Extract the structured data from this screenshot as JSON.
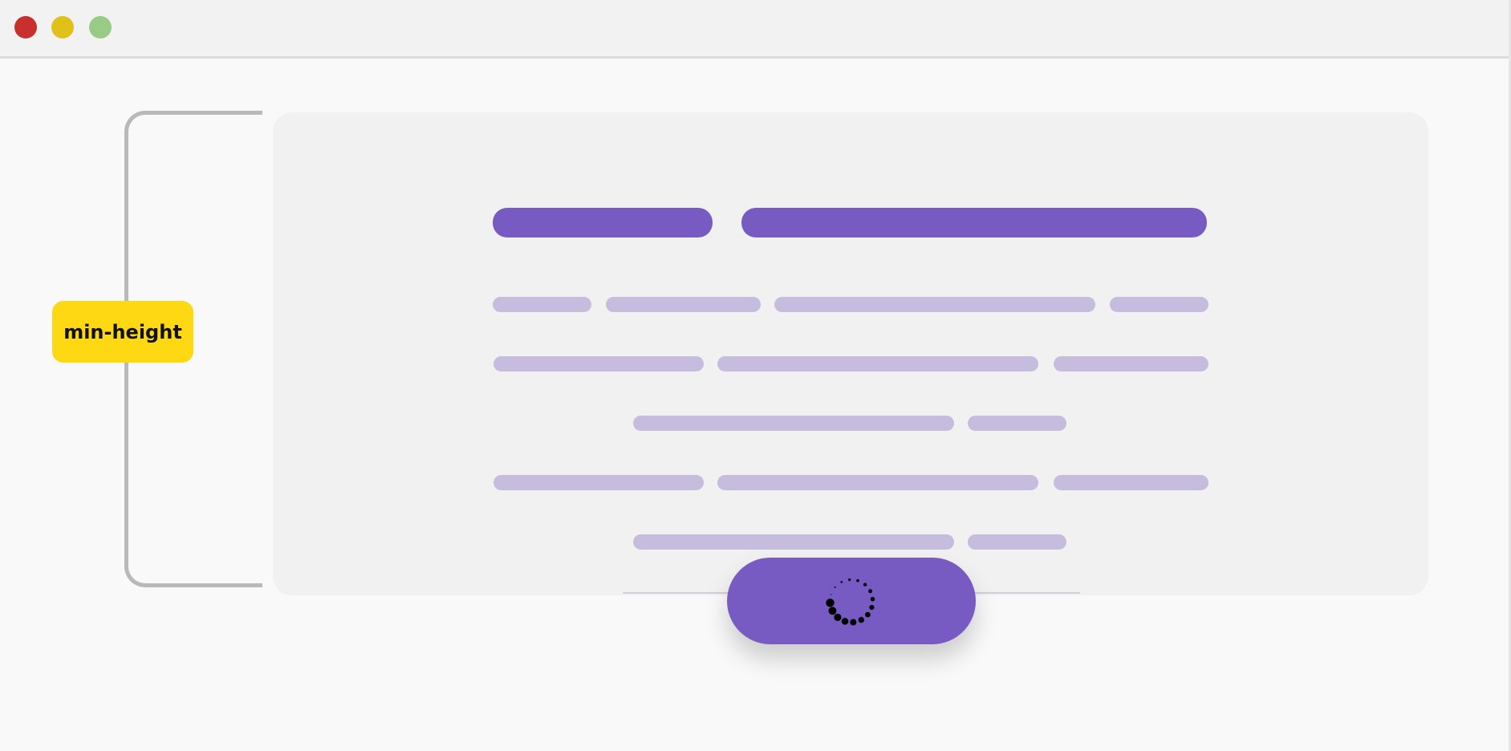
{
  "colors": {
    "titlebar_bg": "#f2f2f2",
    "page_bg": "#f9f9f9",
    "panel_bg": "#f1f1f1",
    "close": "#c8302e",
    "minimize": "#e2c01a",
    "maximize": "#98cb85",
    "accent": "#775bc3",
    "skeleton": "#c6bcdd",
    "label_bg": "#ffd814",
    "bracket": "#b9b9b9"
  },
  "window": {
    "controls": [
      "close",
      "minimize",
      "maximize"
    ]
  },
  "annotation": {
    "label": "min-height"
  },
  "loading_button": {
    "state": "loading",
    "icon": "spinner-icon"
  }
}
